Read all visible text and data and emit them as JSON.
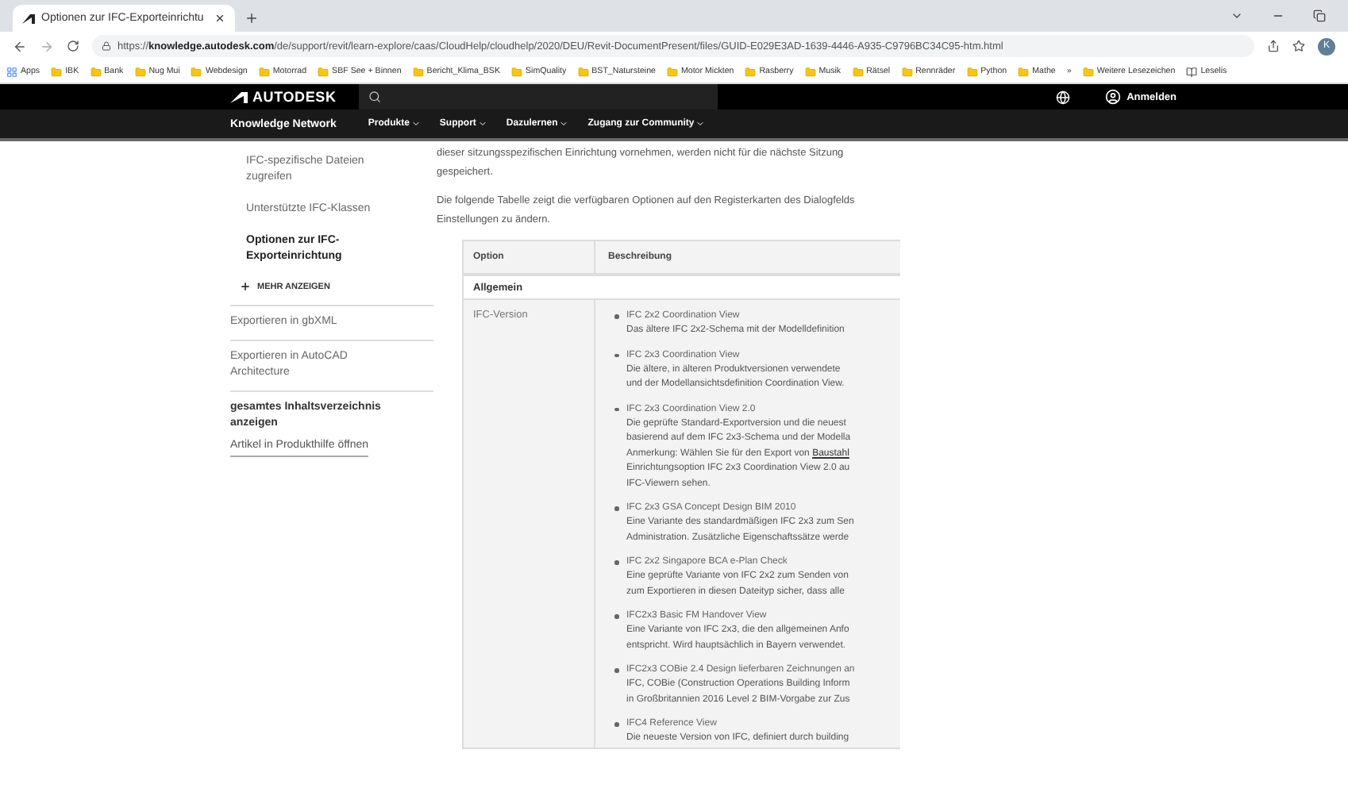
{
  "browser": {
    "tabs": [
      {
        "title": "Optionen zur IFC-Exporteinrichtu",
        "selected": true
      }
    ],
    "url_scheme": "https://",
    "url_host": "knowledge.autodesk.com",
    "url_path": "/de/support/revit/learn-explore/caas/CloudHelp/cloudhelp/2020/DEU/Revit-DocumentPresent/files/GUID-E029E3AD-1639-4446-A935-C9796BC34C95-htm.html",
    "avatar": "K",
    "bookmarks": [
      {
        "kind": "apps",
        "label": "Apps"
      },
      {
        "kind": "folder",
        "label": "IBK"
      },
      {
        "kind": "folder",
        "label": "Bank"
      },
      {
        "kind": "folder",
        "label": "Nug Mui"
      },
      {
        "kind": "folder",
        "label": "Webdesign"
      },
      {
        "kind": "folder",
        "label": "Motorrad"
      },
      {
        "kind": "folder",
        "label": "SBF See + Binnen"
      },
      {
        "kind": "folder",
        "label": "Bericht_Klima_BSK"
      },
      {
        "kind": "folder",
        "label": "SimQuality"
      },
      {
        "kind": "folder",
        "label": "BST_Natursteine"
      },
      {
        "kind": "folder",
        "label": "Motor Mickten"
      },
      {
        "kind": "folder",
        "label": "Rasberry"
      },
      {
        "kind": "folder",
        "label": "Musik"
      },
      {
        "kind": "folder",
        "label": "Rätsel"
      },
      {
        "kind": "folder",
        "label": "Rennräder"
      },
      {
        "kind": "folder",
        "label": "Python"
      },
      {
        "kind": "folder",
        "label": "Mathe"
      },
      {
        "kind": "more",
        "label": "»"
      },
      {
        "kind": "folder",
        "label": "Weitere Lesezeichen"
      },
      {
        "kind": "list",
        "label": "Leselis"
      }
    ]
  },
  "header": {
    "logo": "AUTODESK",
    "sign_in": "Anmelden"
  },
  "nav": {
    "title": "Knowledge Network",
    "items": [
      "Produkte",
      "Support",
      "Dazulernen",
      "Zugang zur Community"
    ]
  },
  "sidebar": {
    "items": [
      {
        "kind": "link",
        "label": "IFC-spezifische Dateien zugreifen",
        "selected": false
      },
      {
        "kind": "link",
        "label": "Unterstützte IFC-Klassen",
        "selected": false
      },
      {
        "kind": "link",
        "label": "Optionen zur IFC-Exporteinrichtung",
        "selected": true
      },
      {
        "kind": "more",
        "label": "MEHR ANZEIGEN"
      },
      {
        "kind": "section",
        "label": "Exportieren in gbXML"
      },
      {
        "kind": "section",
        "label": "Exportieren in AutoCAD Architecture"
      },
      {
        "kind": "heading",
        "label": "gesamtes Inhaltsverzeichnis anzeigen"
      },
      {
        "kind": "open",
        "label": "Artikel in Produkthilfe öffnen"
      }
    ]
  },
  "content": {
    "paragraphs": [
      "dieser sitzungsspezifischen Einrichtung vornehmen, werden nicht für die nächste Sitzung gespeichert.",
      "Die folgende Tabelle zeigt die verfügbaren Optionen auf den Registerkarten des Dialogfelds Einstellungen zu ändern."
    ],
    "table": {
      "columns": [
        "Option",
        "Beschreibung"
      ],
      "group": "Allgemein",
      "rows": [
        {
          "option": "IFC-Version",
          "items": [
            {
              "title": "IFC 2x2 Coordination View",
              "lines": [
                {
                  "text": "Das ältere IFC 2x2-Schema mit der Modelldefinition"
                }
              ]
            },
            {
              "title": "IFC 2x3 Coordination View",
              "lines": [
                {
                  "text": "Die ältere, in älteren Produktversionen verwendete"
                },
                {
                  "text": "und der Modellansichtsdefinition Coordination View."
                }
              ]
            },
            {
              "title": "IFC 2x3 Coordination View 2.0",
              "lines": [
                {
                  "text": "Die geprüfte Standard-Exportversion und die neuest"
                },
                {
                  "text": "basierend auf dem IFC 2x3-Schema und der Modella"
                },
                {
                  "text": "Anmerkung: Wählen Sie für den Export von ",
                  "link": "Baustahl"
                },
                {
                  "text": "Einrichtungsoption IFC 2x3 Coordination View 2.0 au"
                },
                {
                  "text": "IFC-Viewern sehen."
                }
              ]
            },
            {
              "title": "IFC 2x3 GSA Concept Design BIM 2010",
              "lines": [
                {
                  "text": "Eine Variante des standardmäßigen IFC 2x3 zum Sen"
                },
                {
                  "text": "Administration. Zusätzliche Eigenschaftssätze werde"
                }
              ]
            },
            {
              "title": "IFC 2x2 Singapore BCA e-Plan Check",
              "lines": [
                {
                  "text": "Eine geprüfte Variante von IFC 2x2 zum Senden von"
                },
                {
                  "text": "zum Exportieren in diesen Dateityp sicher, dass alle"
                }
              ]
            },
            {
              "title": "IFC2x3 Basic FM Handover View",
              "lines": [
                {
                  "text": "Eine Variante von IFC 2x3, die den allgemeinen Anfo"
                },
                {
                  "text": "entspricht. Wird hauptsächlich in Bayern verwendet."
                }
              ]
            },
            {
              "title": "IFC2x3 COBie 2.4 Design lieferbaren Zeichnungen an",
              "lines": [
                {
                  "text": "IFC, COBie (Construction Operations Building Inform"
                },
                {
                  "text": "in Großbritannien 2016 Level 2 BIM-Vorgabe zur Zus"
                }
              ]
            },
            {
              "title": "IFC4 Reference View",
              "lines": [
                {
                  "text": "Die neueste Version von IFC, definiert durch building"
                }
              ]
            }
          ]
        }
      ]
    }
  }
}
